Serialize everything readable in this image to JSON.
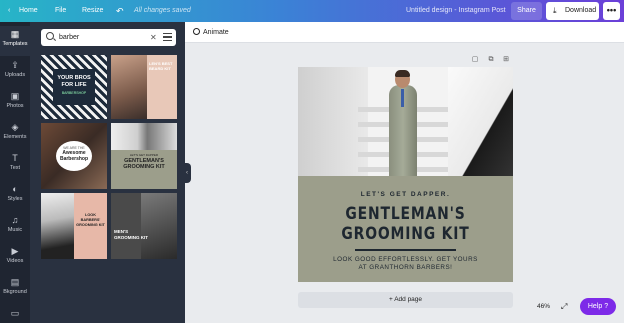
{
  "topbar": {
    "home": "Home",
    "file": "File",
    "resize": "Resize",
    "undo_icon": "undo-icon",
    "save_status": "All changes saved",
    "title": "Untitled design - Instagram Post",
    "share": "Share",
    "download": "Download",
    "more": "•••"
  },
  "rail": {
    "items": [
      {
        "label": "Templates",
        "icon": "▦"
      },
      {
        "label": "Uploads",
        "icon": "⇪"
      },
      {
        "label": "Photos",
        "icon": "▣"
      },
      {
        "label": "Elements",
        "icon": "◈"
      },
      {
        "label": "Text",
        "icon": "T"
      },
      {
        "label": "Styles",
        "icon": "◐"
      },
      {
        "label": "Music",
        "icon": "♫"
      },
      {
        "label": "Videos",
        "icon": "▶"
      },
      {
        "label": "Bkground",
        "icon": "▤"
      },
      {
        "label": "",
        "icon": "▭"
      }
    ]
  },
  "search": {
    "value": "barber",
    "clear": "✕"
  },
  "templates": {
    "t1_big": "YOUR BROS FOR LIFE",
    "t1_small": "BARBERSHOP",
    "t2_text": "LEN'S BEST BEARD KIT",
    "t3_top": "WE ARE THE",
    "t3_title": "Awesome Barbershop",
    "t4_top": "LET'S GET DAPPER",
    "t4_title": "GENTLEMAN'S GROOMING KIT",
    "t5_title": "LOOK BARBERS' GROOMING KIT",
    "t6_title": "MEN'S GROOMING KIT"
  },
  "canvas": {
    "animate": "Animate",
    "kicker": "LET'S GET DAPPER.",
    "title_line1": "GENTLEMAN'S",
    "title_line2": "GROOMING KIT",
    "sub_line1": "LOOK GOOD EFFORTLESSLY. GET YOURS",
    "sub_line2": "AT GRANTHORN BARBERS!",
    "add_page": "+ Add page"
  },
  "footer": {
    "zoom": "46%",
    "help": "Help ?"
  }
}
